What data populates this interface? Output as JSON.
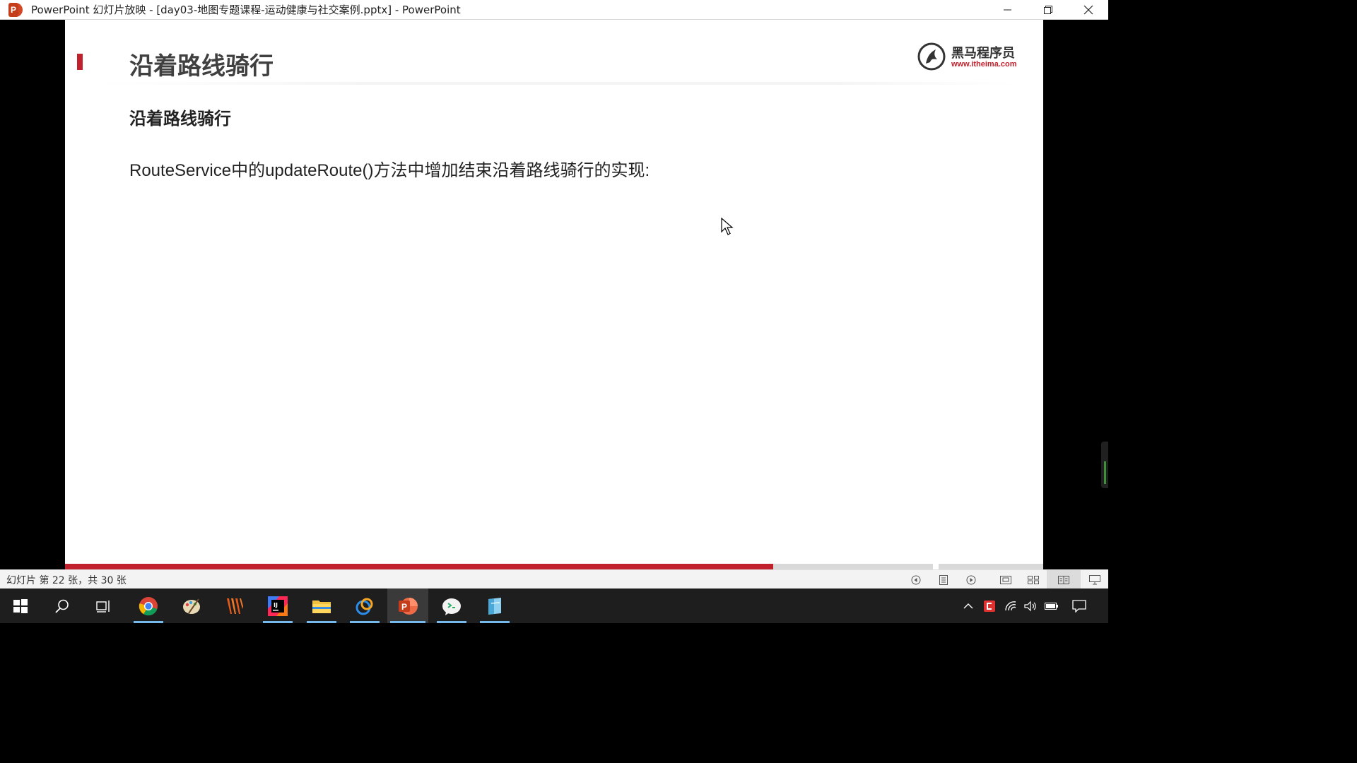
{
  "window": {
    "title": "PowerPoint 幻灯片放映 - [day03-地图专题课程-运动健康与社交案例.pptx] - PowerPoint",
    "app_icon_letter": "P",
    "controls": [
      "minimize-icon",
      "restore-icon",
      "close-icon"
    ]
  },
  "slide": {
    "title": "沿着路线骑行",
    "subtitle": "沿着路线骑行",
    "body": "RouteService中的updateRoute()方法中增加结束沿着路线骑行的实现:",
    "logo": {
      "name_cn": "黑马程序员",
      "url": "www.itheima.com"
    },
    "accent_color": "#c0212c",
    "progress": {
      "current": 22,
      "total": 30
    }
  },
  "status": {
    "slide_counter": "幻灯片 第 22 张，共 30 张",
    "icons": [
      "previous-icon",
      "notes-icon",
      "next-icon",
      "normal-view-icon",
      "slide-sorter-icon",
      "reading-view-icon",
      "slideshow-icon"
    ],
    "active_view": "reading-view-icon"
  },
  "taskbar": {
    "apps": [
      "start-icon",
      "search-icon",
      "task-view-icon",
      "chrome-icon",
      "paint-icon",
      "editor-icon",
      "intellij-icon",
      "file-explorer-icon",
      "browser-icon",
      "powerpoint-icon",
      "wechat-icon",
      "notepad-icon"
    ],
    "active_app": "powerpoint-icon",
    "tray": [
      "show-hidden-icons-icon",
      "tray-app-icon",
      "network-icon",
      "volume-icon",
      "battery-icon",
      "notification-icon"
    ]
  }
}
